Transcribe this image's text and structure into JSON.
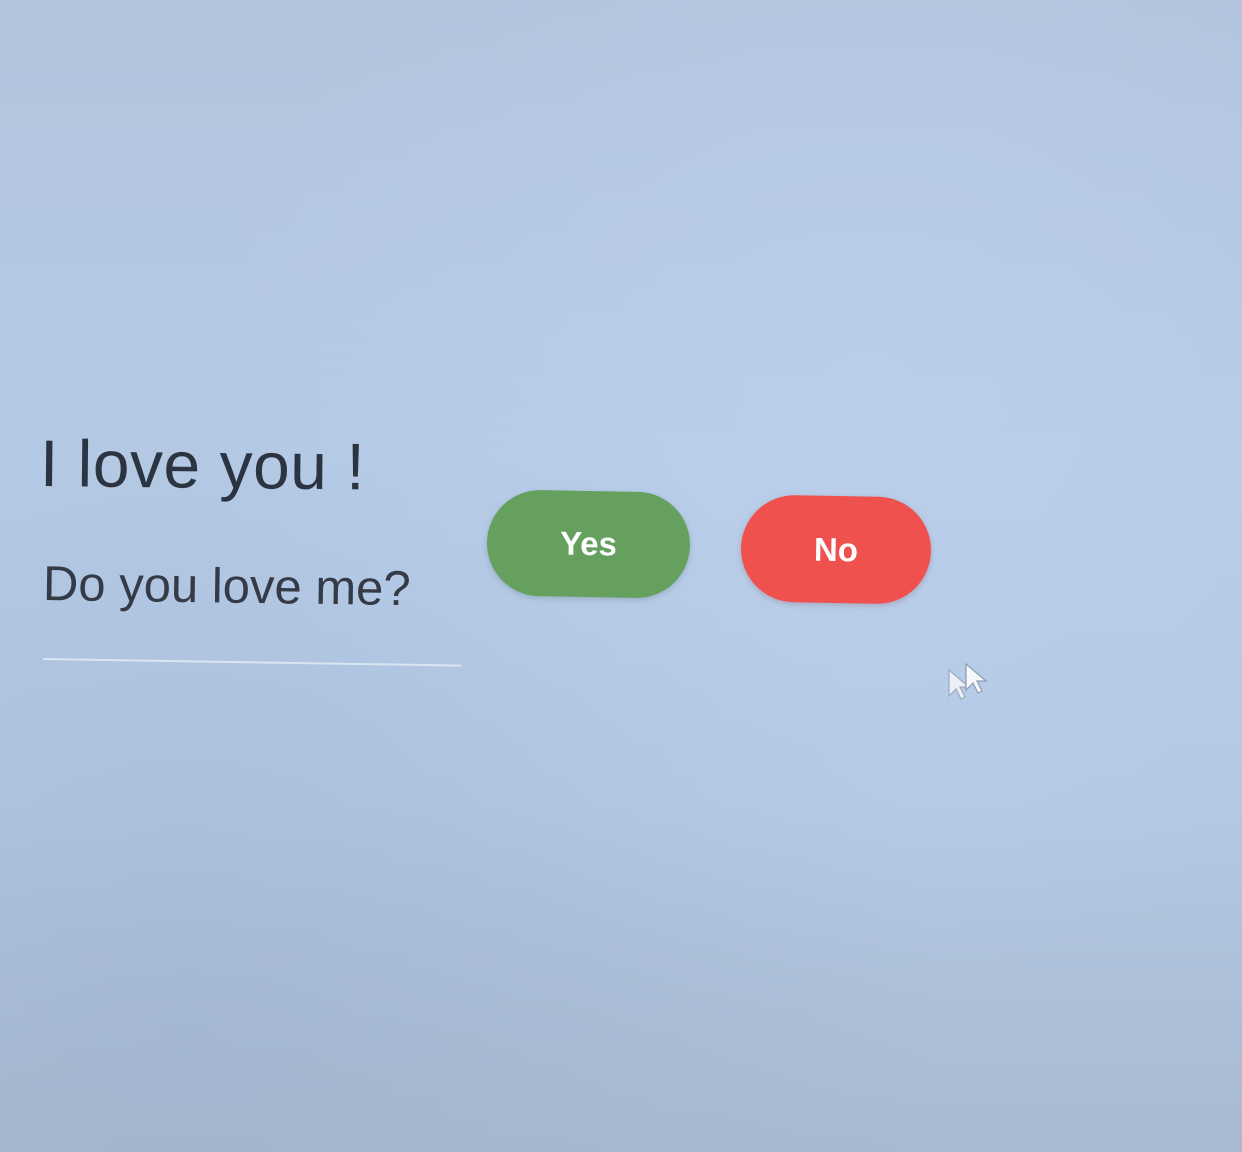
{
  "content": {
    "heading": "I love you !",
    "question": "Do you love me?"
  },
  "buttons": {
    "yes_label": "Yes",
    "no_label": "No"
  },
  "colors": {
    "yes_button": "#65a05e",
    "no_button": "#ee514e",
    "background": "#b6cbe6",
    "text": "#2c3442"
  },
  "icons": {
    "pointer": "mouse-pointer-icon"
  }
}
